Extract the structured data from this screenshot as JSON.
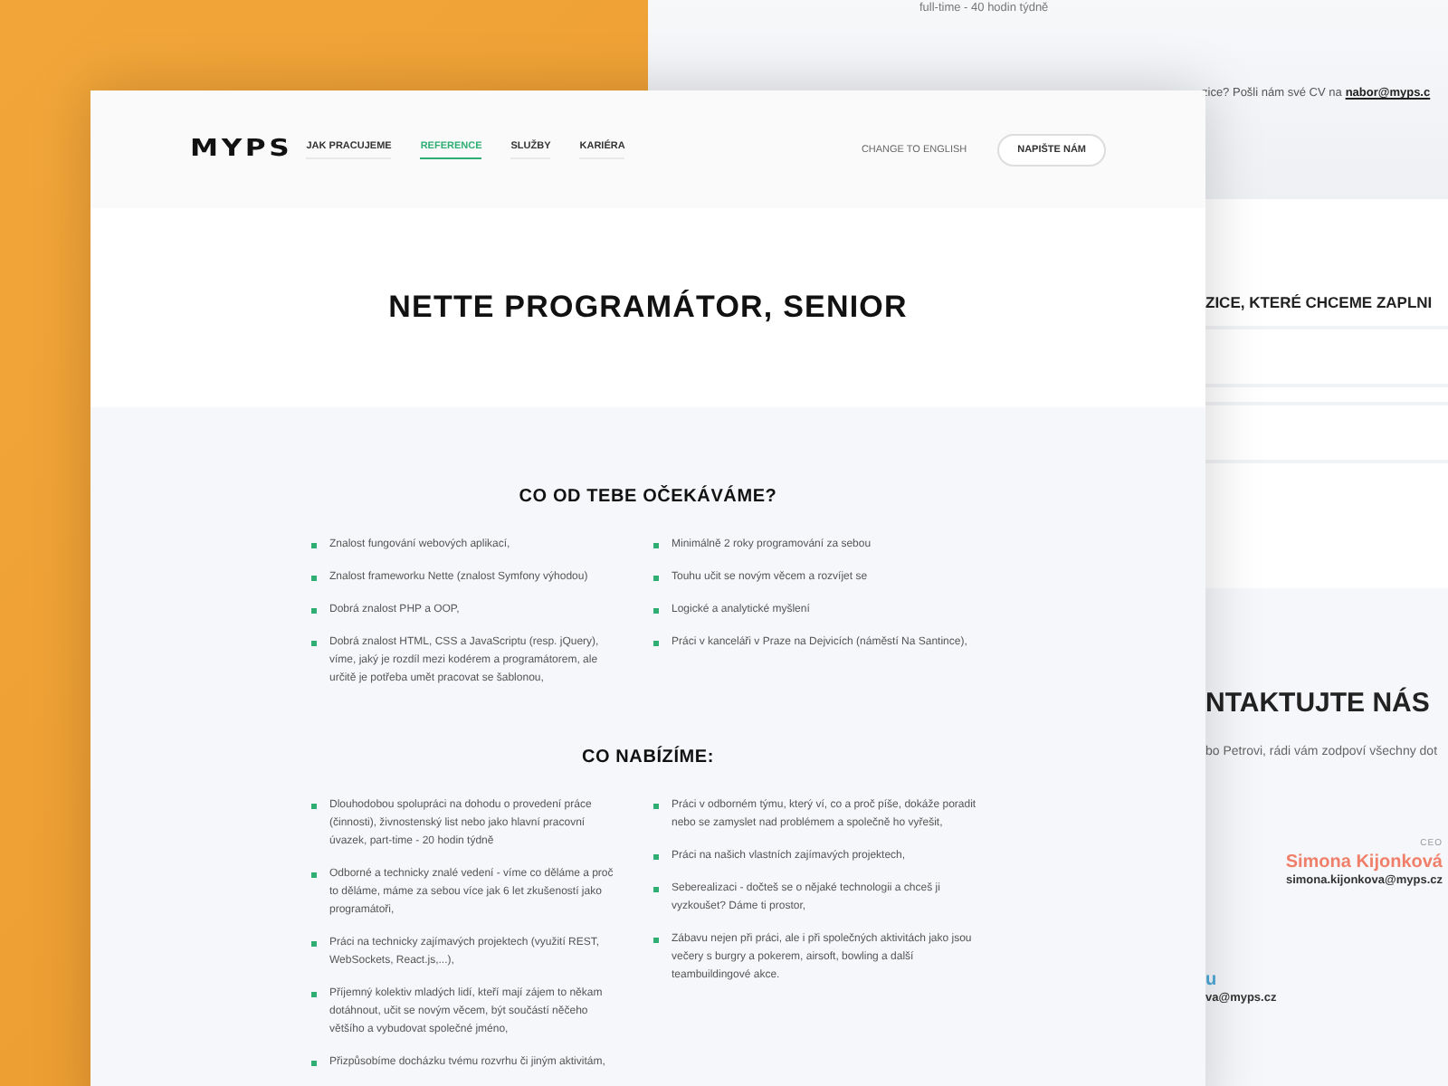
{
  "back_page": {
    "hours": "full-time - 40 hodin týdně",
    "cv_text": "zice? Pošli nám své CV na",
    "cv_email": "nabor@myps.c",
    "positions_heading": "ZICE, KTERÉ CHCEME ZAPLNI",
    "contact_heading": "NTAKTUJTE NÁS",
    "contact_text": "bo Petrovi, rádi vám zodpoví všechny dot",
    "contacts": [
      {
        "role": "CEO",
        "name": "Simona Kijonková",
        "email": "simona.kijonkova@myps.cz",
        "color": "#f07f6a"
      },
      {
        "name": "u",
        "email": "va@myps.cz",
        "color": "#4aa8d8"
      }
    ]
  },
  "front_page": {
    "logo": "MYPS",
    "nav": [
      {
        "label": "JAK PRACUJEME",
        "selected": false
      },
      {
        "label": "REFERENCE",
        "selected": true
      },
      {
        "label": "SLUŽBY",
        "selected": false
      },
      {
        "label": "KARIÉRA",
        "selected": false
      }
    ],
    "language_link": "CHANGE TO ENGLISH",
    "contact_button": "NAPIŠTE NÁM",
    "title": "NETTE PROGRAMÁTOR, SENIOR",
    "sections": [
      {
        "heading": "CO OD TEBE OČEKÁVÁME?",
        "columns": [
          [
            "Znalost fungování webových aplikací,",
            "Znalost frameworku Nette (znalost Symfony výhodou)",
            "Dobrá znalost PHP a OOP,",
            "Dobrá znalost HTML, CSS a JavaScriptu (resp. jQuery), víme, jaký je rozdíl mezi kodérem a programátorem, ale určitě je potřeba umět pracovat se šablonou,"
          ],
          [
            "Minimálně 2 roky programování za sebou",
            "Touhu učit se novým věcem a rozvíjet se",
            "Logické a analytické myšlení",
            "Práci v kanceláři v Praze na Dejvicích (náměstí Na Santince),"
          ]
        ]
      },
      {
        "heading": "CO NABÍZÍME:",
        "columns": [
          [
            "Dlouhodobou spolupráci na dohodu o provedení práce (činnosti), živnostenský list nebo jako hlavní pracovní úvazek, part-time - 20 hodin týdně",
            "Odborné a technicky znalé vedení - víme co děláme a proč to děláme, máme za sebou více jak 6 let zkušeností jako programátoři,",
            "Práci na technicky zajímavých projektech (využití REST, WebSockets, React.js,...),",
            "Příjemný kolektiv mladých lidí, kteří mají zájem to někam dotáhnout, učit se novým věcem, být součástí něčeho většího a vybudovat společné jméno,",
            "Přizpůsobíme docházku tvému rozvrhu či jiným aktivitám,"
          ],
          [
            "Práci v odborném týmu, který ví, co a proč píše, dokáže poradit nebo se zamyslet nad problémem a společně ho vyřešit,",
            "Práci na našich vlastních zajímavých projektech,",
            "Seberealizaci - dočteš se o nějaké technologii a chceš ji vyzkoušet? Dáme ti prostor,",
            "Zábavu nejen při práci, ale i při společných aktivitách jako jsou večery s burgry a pokerem, airsoft, bowling a další teambuildingové akce."
          ]
        ]
      }
    ]
  }
}
